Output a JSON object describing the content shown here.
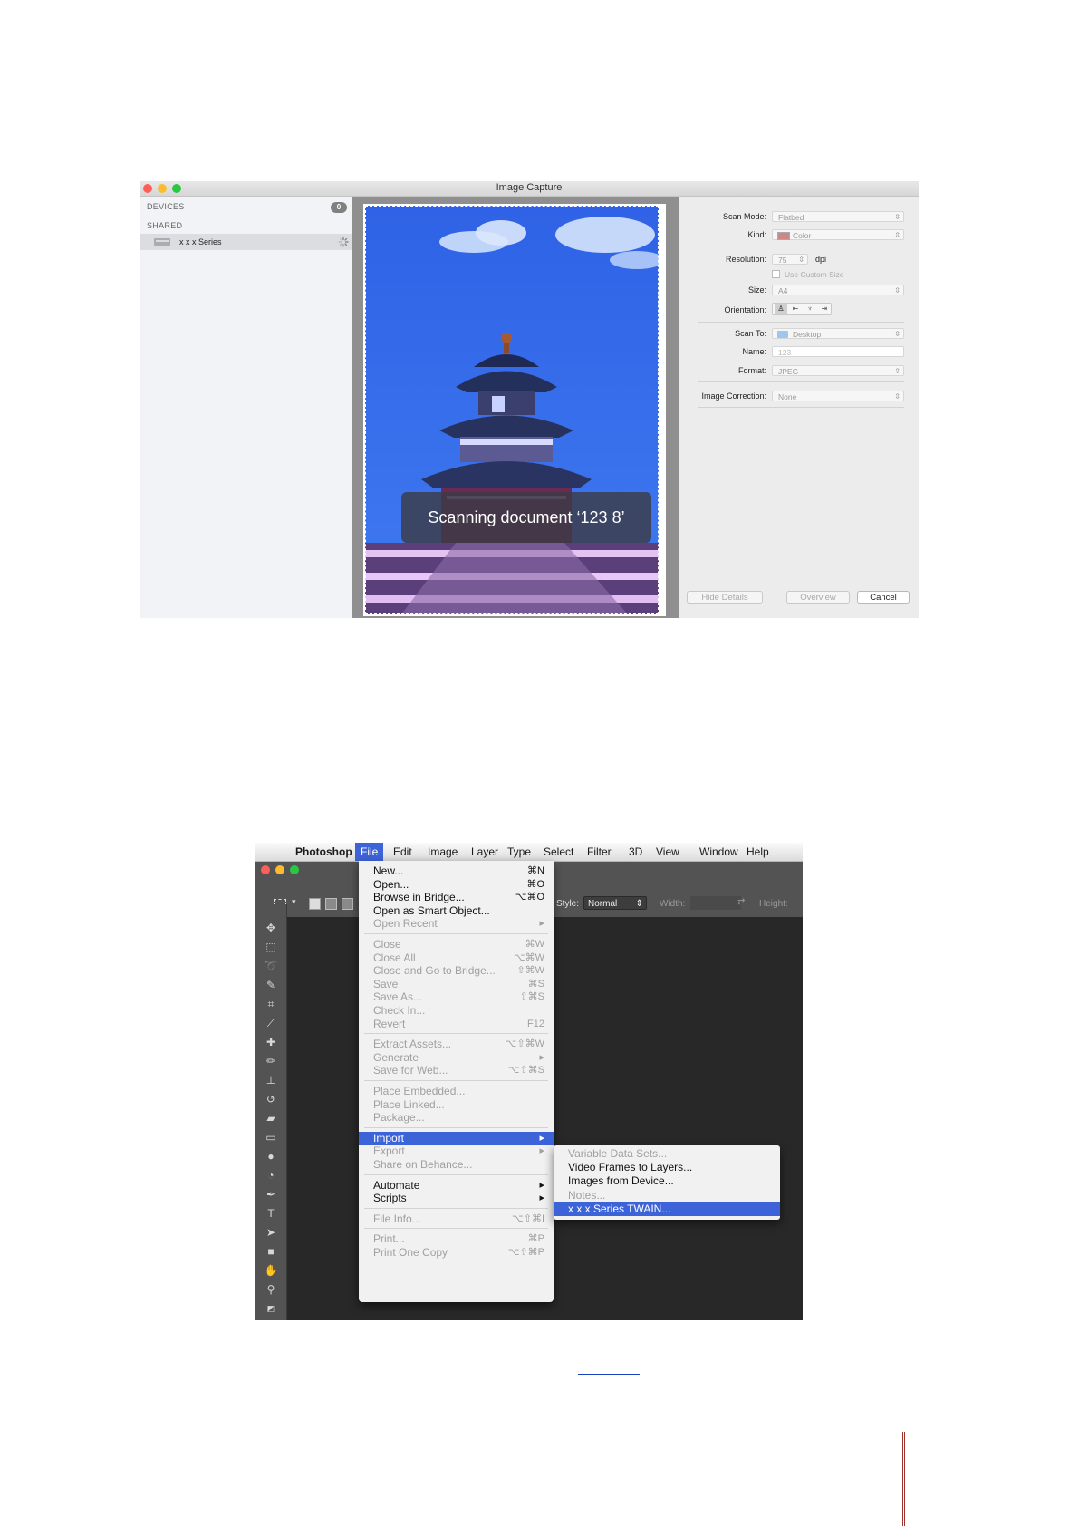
{
  "image_capture": {
    "window_title": "Image Capture",
    "sidebar": {
      "devices_header": "DEVICES",
      "devices_count": "0",
      "shared_header": "SHARED",
      "device_name": "x x x  Series"
    },
    "scanning_message": "Scanning document ‘123 8’",
    "settings": {
      "scan_mode": {
        "label": "Scan Mode:",
        "value": "Flatbed"
      },
      "kind": {
        "label": "Kind:",
        "value": "Color"
      },
      "resolution": {
        "label": "Resolution:",
        "value": "75",
        "unit": "dpi"
      },
      "custom_size": {
        "label": "Use Custom Size"
      },
      "size": {
        "label": "Size:",
        "value": "A4"
      },
      "orientation": {
        "label": "Orientation:"
      },
      "scan_to": {
        "label": "Scan To:",
        "value": "Desktop"
      },
      "name": {
        "label": "Name:",
        "value": "123"
      },
      "format": {
        "label": "Format:",
        "value": "JPEG"
      },
      "image_correction": {
        "label": "Image Correction:",
        "value": "None"
      }
    },
    "buttons": {
      "hide_details": "Hide Details",
      "overview": "Overview",
      "cancel": "Cancel"
    }
  },
  "photoshop": {
    "menubar": [
      "Photoshop",
      "File",
      "Edit",
      "Image",
      "Layer",
      "Type",
      "Select",
      "Filter",
      "3D",
      "View",
      "Window",
      "Help"
    ],
    "options": {
      "style_label": "Style:",
      "style_value": "Normal",
      "width_label": "Width:",
      "height_label": "Height:"
    },
    "file_menu": [
      {
        "label": "New...",
        "shortcut": "⌘N",
        "enabled": true
      },
      {
        "label": "Open...",
        "shortcut": "⌘O",
        "enabled": true
      },
      {
        "label": "Browse in Bridge...",
        "shortcut": "⌥⌘O",
        "enabled": true
      },
      {
        "label": "Open as Smart Object...",
        "shortcut": "",
        "enabled": true
      },
      {
        "label": "Open Recent",
        "shortcut": "▸",
        "enabled": false
      },
      {
        "separator": true
      },
      {
        "label": "Close",
        "shortcut": "⌘W",
        "enabled": false
      },
      {
        "label": "Close All",
        "shortcut": "⌥⌘W",
        "enabled": false
      },
      {
        "label": "Close and Go to Bridge...",
        "shortcut": "⇧⌘W",
        "enabled": false
      },
      {
        "label": "Save",
        "shortcut": "⌘S",
        "enabled": false
      },
      {
        "label": "Save As...",
        "shortcut": "⇧⌘S",
        "enabled": false
      },
      {
        "label": "Check In...",
        "shortcut": "",
        "enabled": false
      },
      {
        "label": "Revert",
        "shortcut": "F12",
        "enabled": false
      },
      {
        "separator": true
      },
      {
        "label": "Extract Assets...",
        "shortcut": "⌥⇧⌘W",
        "enabled": false
      },
      {
        "label": "Generate",
        "shortcut": "▸",
        "enabled": false
      },
      {
        "label": "Save for Web...",
        "shortcut": "⌥⇧⌘S",
        "enabled": false
      },
      {
        "separator": true
      },
      {
        "label": "Place Embedded...",
        "shortcut": "",
        "enabled": false
      },
      {
        "label": "Place Linked...",
        "shortcut": "",
        "enabled": false
      },
      {
        "label": "Package...",
        "shortcut": "",
        "enabled": false
      },
      {
        "separator": true
      },
      {
        "label": "Import",
        "shortcut": "▸",
        "enabled": true,
        "highlighted": true
      },
      {
        "label": "Export",
        "shortcut": "▸",
        "enabled": false
      },
      {
        "label": "Share on Behance...",
        "shortcut": "",
        "enabled": false
      },
      {
        "separator": true
      },
      {
        "label": "Automate",
        "shortcut": "▸",
        "enabled": true
      },
      {
        "label": "Scripts",
        "shortcut": "▸",
        "enabled": true
      },
      {
        "separator": true
      },
      {
        "label": "File Info...",
        "shortcut": "⌥⇧⌘I",
        "enabled": false
      },
      {
        "separator": true
      },
      {
        "label": "Print...",
        "shortcut": "⌘P",
        "enabled": false
      },
      {
        "label": "Print One Copy",
        "shortcut": "⌥⇧⌘P",
        "enabled": false
      }
    ],
    "import_submenu": [
      {
        "label": "Variable Data Sets...",
        "enabled": false
      },
      {
        "label": "Video Frames to Layers...",
        "enabled": true
      },
      {
        "label": "Images from Device...",
        "enabled": true
      },
      {
        "label": "Notes...",
        "enabled": false
      },
      {
        "label": "x x x  Series TWAIN...",
        "enabled": true,
        "highlighted": true
      }
    ]
  }
}
